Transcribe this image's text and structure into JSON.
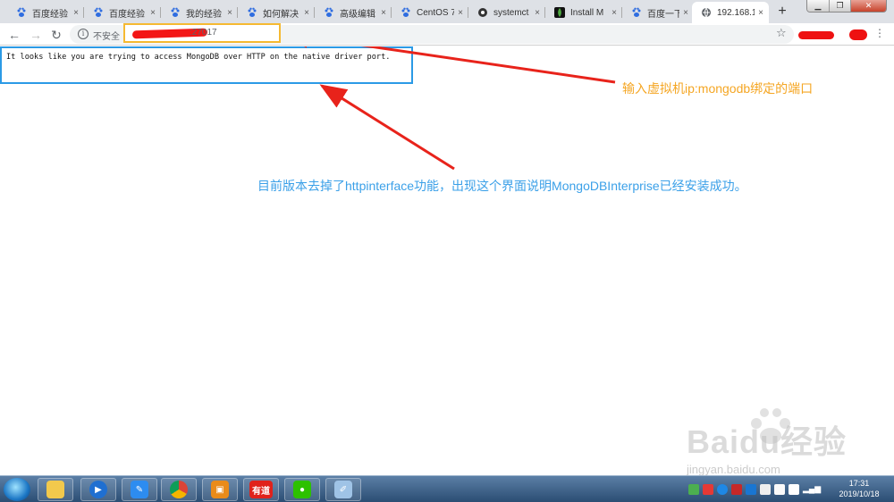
{
  "tabs": [
    {
      "title": "百度经验",
      "icon": "baidu-paw-icon"
    },
    {
      "title": "百度经验",
      "icon": "baidu-paw-icon"
    },
    {
      "title": "我的经验",
      "icon": "baidu-paw-icon"
    },
    {
      "title": "如何解决",
      "icon": "baidu-paw-icon"
    },
    {
      "title": "高级编辑",
      "icon": "baidu-paw-icon"
    },
    {
      "title": "CentOS 7",
      "icon": "baidu-paw-icon"
    },
    {
      "title": "systemct",
      "icon": "github-icon"
    },
    {
      "title": "Install M",
      "icon": "mongodb-leaf-icon"
    },
    {
      "title": "百度一下",
      "icon": "baidu-paw-icon"
    },
    {
      "title": "192.168.1",
      "icon": "globe-icon"
    }
  ],
  "toolbar": {
    "security_label": "不安全",
    "url_port": ":27017"
  },
  "page": {
    "message": "It looks like you are trying to access MongoDB over HTTP on the native driver port."
  },
  "annotations": {
    "port_note": "输入虚拟机ip:mongodb绑定的端口",
    "feature_note": "目前版本去掉了httpinterface功能，出现这个界面说明MongoDBInterprise已经安装成功。"
  },
  "watermark": {
    "logo": "Baidu经验",
    "url": "jingyan.baidu.com"
  },
  "taskbar": {
    "apps": [
      "file-explorer-icon",
      "media-player-icon",
      "feather-pen-icon",
      "chrome-icon",
      "vmware-icon",
      "youdao-icon",
      "wechat-icon",
      "paint-icon"
    ],
    "youdao_label": "有道",
    "time": "17:31",
    "date": "2019/10/18"
  },
  "colors": {
    "annotation_orange": "#f5a623",
    "annotation_blue": "#3ba0e8",
    "arrow_red": "#e8231b",
    "box_blue": "#2b9ae6",
    "box_yellow": "#f5b932"
  }
}
